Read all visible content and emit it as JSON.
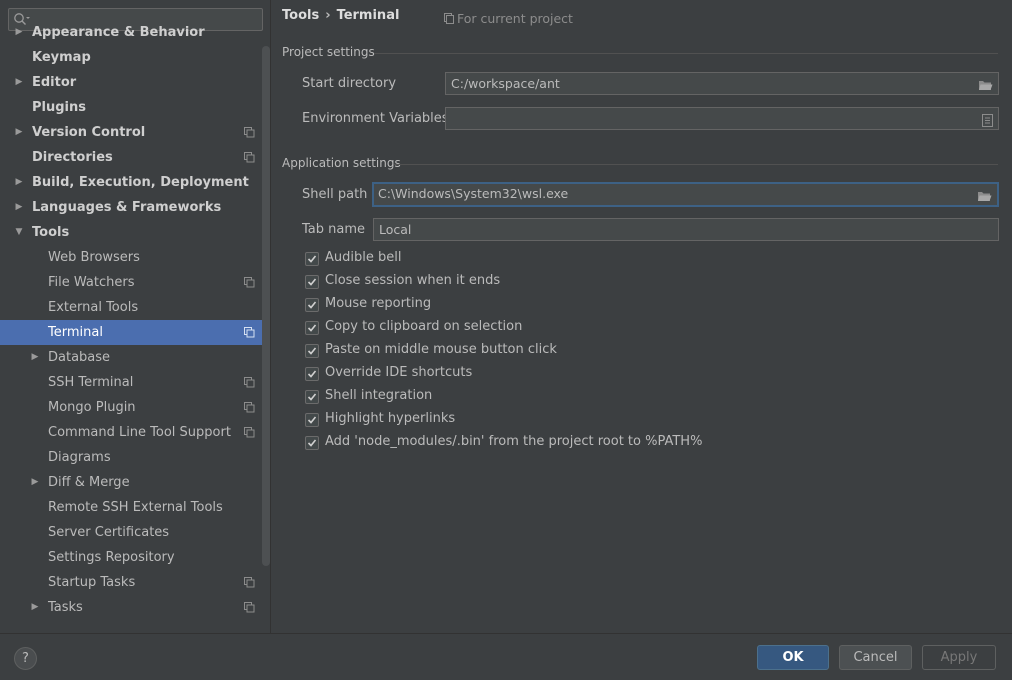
{
  "search": {
    "placeholder": ""
  },
  "sidebar": {
    "items": [
      {
        "label": "Appearance & Behavior",
        "level": 0,
        "arrow": "▶",
        "project": false
      },
      {
        "label": "Keymap",
        "level": 0,
        "arrow": "",
        "project": false
      },
      {
        "label": "Editor",
        "level": 0,
        "arrow": "▶",
        "project": false
      },
      {
        "label": "Plugins",
        "level": 0,
        "arrow": "",
        "project": false
      },
      {
        "label": "Version Control",
        "level": 0,
        "arrow": "▶",
        "project": true
      },
      {
        "label": "Directories",
        "level": 0,
        "arrow": "",
        "project": true
      },
      {
        "label": "Build, Execution, Deployment",
        "level": 0,
        "arrow": "▶",
        "project": false
      },
      {
        "label": "Languages & Frameworks",
        "level": 0,
        "arrow": "▶",
        "project": false
      },
      {
        "label": "Tools",
        "level": 0,
        "arrow": "▼",
        "project": false
      },
      {
        "label": "Web Browsers",
        "level": 1,
        "arrow": "",
        "project": false
      },
      {
        "label": "File Watchers",
        "level": 1,
        "arrow": "",
        "project": true
      },
      {
        "label": "External Tools",
        "level": 1,
        "arrow": "",
        "project": false
      },
      {
        "label": "Terminal",
        "level": 1,
        "arrow": "",
        "project": true,
        "selected": true
      },
      {
        "label": "Database",
        "level": 1,
        "arrow": "▶",
        "project": false
      },
      {
        "label": "SSH Terminal",
        "level": 1,
        "arrow": "",
        "project": true
      },
      {
        "label": "Mongo Plugin",
        "level": 1,
        "arrow": "",
        "project": true
      },
      {
        "label": "Command Line Tool Support",
        "level": 1,
        "arrow": "",
        "project": true
      },
      {
        "label": "Diagrams",
        "level": 1,
        "arrow": "",
        "project": false
      },
      {
        "label": "Diff & Merge",
        "level": 1,
        "arrow": "▶",
        "project": false
      },
      {
        "label": "Remote SSH External Tools",
        "level": 1,
        "arrow": "",
        "project": false
      },
      {
        "label": "Server Certificates",
        "level": 1,
        "arrow": "",
        "project": false
      },
      {
        "label": "Settings Repository",
        "level": 1,
        "arrow": "",
        "project": false
      },
      {
        "label": "Startup Tasks",
        "level": 1,
        "arrow": "",
        "project": true
      },
      {
        "label": "Tasks",
        "level": 1,
        "arrow": "▶",
        "project": true
      }
    ]
  },
  "header": {
    "crumb_parent": "Tools",
    "crumb_current": "Terminal",
    "for_project": "For current project"
  },
  "project_settings": {
    "title": "Project settings",
    "start_directory_label": "Start directory",
    "start_directory_value": "C:/workspace/ant",
    "env_vars_label": "Environment Variables",
    "env_vars_value": ""
  },
  "app_settings": {
    "title": "Application settings",
    "shell_path_label": "Shell path",
    "shell_path_value": "C:\\Windows\\System32\\wsl.exe",
    "tab_name_label": "Tab name",
    "tab_name_value": "Local",
    "checkboxes": [
      {
        "label": "Audible bell",
        "checked": true
      },
      {
        "label": "Close session when it ends",
        "checked": true
      },
      {
        "label": "Mouse reporting",
        "checked": true
      },
      {
        "label": "Copy to clipboard on selection",
        "checked": true
      },
      {
        "label": "Paste on middle mouse button click",
        "checked": true
      },
      {
        "label": "Override IDE shortcuts",
        "checked": true
      },
      {
        "label": "Shell integration",
        "checked": true
      },
      {
        "label": "Highlight hyperlinks",
        "checked": true
      },
      {
        "label": "Add 'node_modules/.bin' from the project root to %PATH%",
        "checked": true
      }
    ]
  },
  "footer": {
    "help_label": "?",
    "ok_label": "OK",
    "cancel_label": "Cancel",
    "apply_label": "Apply"
  },
  "colors": {
    "selection": "#4b6eaf",
    "ok_button": "#365880",
    "background": "#3c3f41"
  }
}
